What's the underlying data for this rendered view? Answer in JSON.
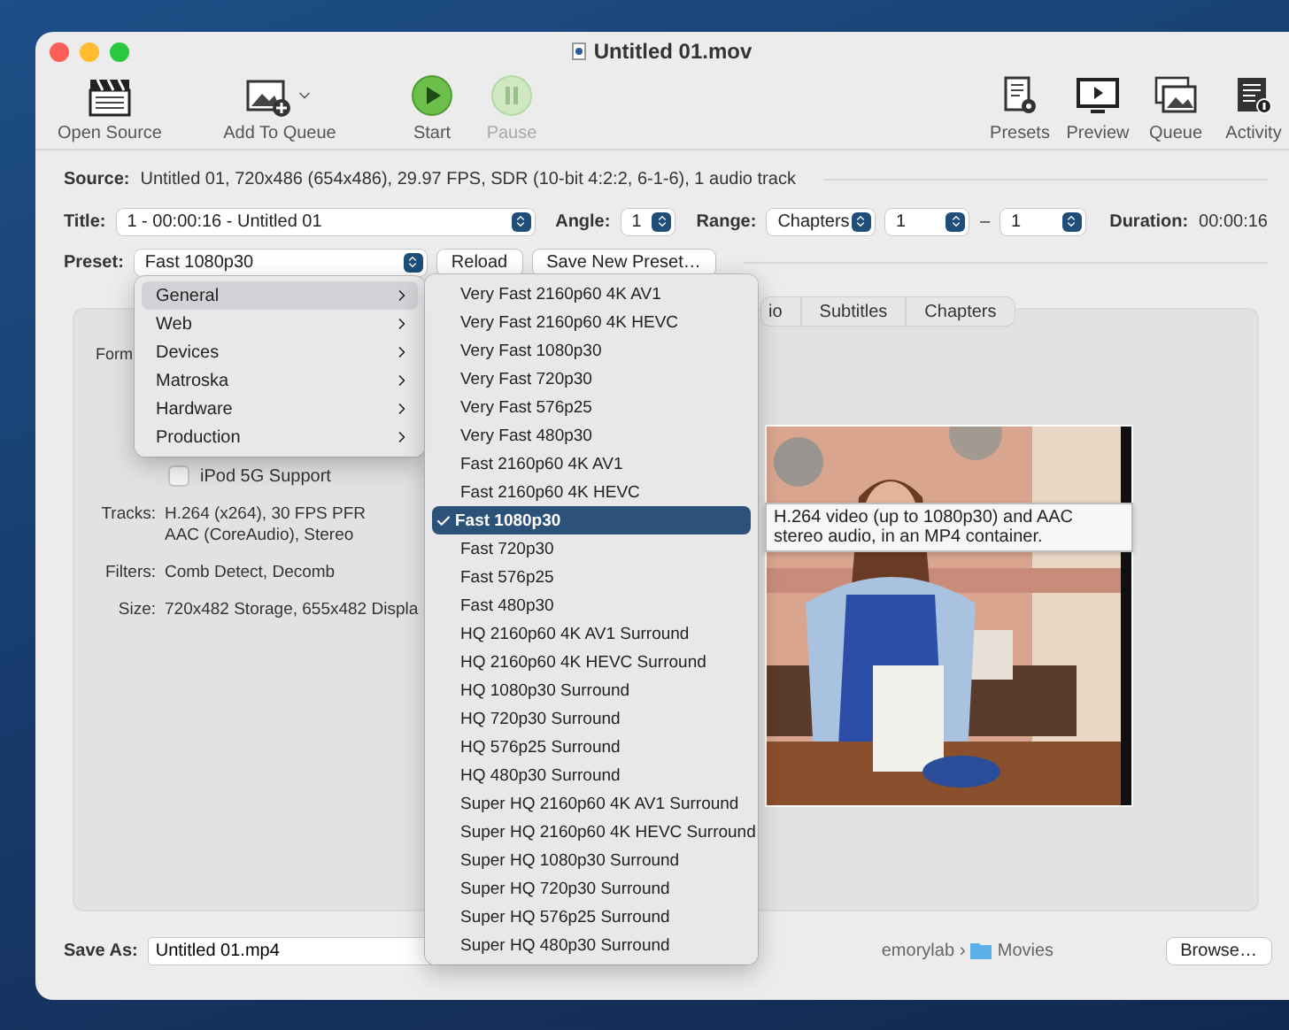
{
  "window": {
    "title": "Untitled 01.mov"
  },
  "toolbar": {
    "left": [
      {
        "label": "Open Source",
        "kind": "clapper",
        "disabled": false
      },
      {
        "label": "Add To Queue",
        "kind": "add-picture",
        "disabled": false
      },
      {
        "label": "Start",
        "kind": "play",
        "disabled": false
      },
      {
        "label": "Pause",
        "kind": "pause",
        "disabled": true
      }
    ],
    "right": [
      {
        "label": "Presets",
        "kind": "document",
        "disabled": false
      },
      {
        "label": "Preview",
        "kind": "monitor",
        "disabled": false
      },
      {
        "label": "Queue",
        "kind": "stack",
        "disabled": false
      },
      {
        "label": "Activity",
        "kind": "log",
        "disabled": false
      }
    ]
  },
  "source": {
    "label": "Source:",
    "value": "Untitled 01, 720x486 (654x486), 29.97 FPS, SDR (10-bit 4:2:2, 6-1-6), 1 audio track"
  },
  "title_row": {
    "title_label": "Title:",
    "title_value": "1 - 00:00:16 - Untitled 01",
    "angle_label": "Angle:",
    "angle_value": "1",
    "range_label": "Range:",
    "range_kind": "Chapters",
    "range_from": "1",
    "range_dash": "–",
    "range_to": "1",
    "duration_label": "Duration:",
    "duration": "00:00:16"
  },
  "preset_row": {
    "label": "Preset:",
    "value": "Fast 1080p30",
    "buttons": [
      "Reload",
      "Save New Preset…"
    ]
  },
  "tabs": [
    {
      "label": "io",
      "selected": false
    },
    {
      "label": "Subtitles",
      "selected": false
    },
    {
      "label": "Chapters",
      "selected": false
    }
  ],
  "summary": {
    "format_label": "Form",
    "ipod": {
      "label": "iPod 5G Support",
      "checked": false
    },
    "rows": [
      {
        "label": "Tracks:",
        "lines": [
          "H.264 (x264), 30 FPS PFR",
          "AAC (CoreAudio), Stereo"
        ]
      },
      {
        "label": "Filters:",
        "lines": [
          "Comb Detect, Decomb"
        ]
      },
      {
        "label": "Size:",
        "lines": [
          "720x482 Storage, 655x482 Displa"
        ]
      }
    ]
  },
  "save": {
    "label": "Save As:",
    "value": "Untitled 01.mp4",
    "path": [
      "emorylab",
      "Movies"
    ],
    "separator": "›",
    "browse": "Browse…"
  },
  "category_menu": [
    {
      "label": "General",
      "selected": true
    },
    {
      "label": "Web",
      "selected": false
    },
    {
      "label": "Devices",
      "selected": false
    },
    {
      "label": "Matroska",
      "selected": false
    },
    {
      "label": "Hardware",
      "selected": false
    },
    {
      "label": "Production",
      "selected": false
    }
  ],
  "preset_menu": [
    {
      "label": "Very Fast 2160p60 4K AV1",
      "selected": false
    },
    {
      "label": "Very Fast 2160p60 4K HEVC",
      "selected": false
    },
    {
      "label": "Very Fast 1080p30",
      "selected": false
    },
    {
      "label": "Very Fast 720p30",
      "selected": false
    },
    {
      "label": "Very Fast 576p25",
      "selected": false
    },
    {
      "label": "Very Fast 480p30",
      "selected": false
    },
    {
      "label": "Fast 2160p60 4K AV1",
      "selected": false
    },
    {
      "label": "Fast 2160p60 4K HEVC",
      "selected": false
    },
    {
      "label": "Fast 1080p30",
      "selected": true
    },
    {
      "label": "Fast 720p30",
      "selected": false
    },
    {
      "label": "Fast 576p25",
      "selected": false
    },
    {
      "label": "Fast 480p30",
      "selected": false
    },
    {
      "label": "HQ 2160p60 4K AV1 Surround",
      "selected": false
    },
    {
      "label": "HQ 2160p60 4K HEVC Surround",
      "selected": false
    },
    {
      "label": "HQ 1080p30 Surround",
      "selected": false
    },
    {
      "label": "HQ 720p30 Surround",
      "selected": false
    },
    {
      "label": "HQ 576p25 Surround",
      "selected": false
    },
    {
      "label": "HQ 480p30 Surround",
      "selected": false
    },
    {
      "label": "Super HQ 2160p60 4K AV1 Surround",
      "selected": false
    },
    {
      "label": "Super HQ 2160p60 4K HEVC Surround",
      "selected": false
    },
    {
      "label": "Super HQ 1080p30 Surround",
      "selected": false
    },
    {
      "label": "Super HQ 720p30 Surround",
      "selected": false
    },
    {
      "label": "Super HQ 576p25 Surround",
      "selected": false
    },
    {
      "label": "Super HQ 480p30 Surround",
      "selected": false
    }
  ],
  "tooltip": "H.264 video (up to 1080p30) and AAC stereo audio, in an MP4 container."
}
